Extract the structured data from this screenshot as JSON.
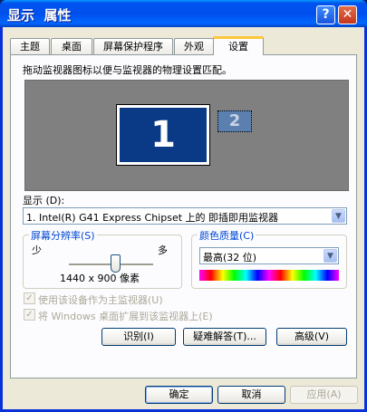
{
  "window": {
    "title": "显示  属性"
  },
  "titlebar_buttons": {
    "help": "?",
    "close": "✕"
  },
  "tabs": [
    {
      "label": "主题"
    },
    {
      "label": "桌面"
    },
    {
      "label": "屏幕保护程序"
    },
    {
      "label": "外观"
    },
    {
      "label": "设置",
      "active": true
    }
  ],
  "settings": {
    "instruction": "拖动监视器图标以便与监视器的物理设置匹配。",
    "monitors": [
      {
        "number": "1",
        "primary": true
      },
      {
        "number": "2"
      }
    ],
    "display_label": "显示 (D):",
    "display_value": "1. Intel(R) G41 Express Chipset 上的 即插即用监视器",
    "resolution": {
      "title": "屏幕分辨率(S)",
      "less": "少",
      "more": "多",
      "value": "1440 x 900 像素",
      "slider_position": 0.55
    },
    "color_quality": {
      "title": "颜色质量(C)",
      "value": "最高(32 位)"
    },
    "checkbox_primary": "使用该设备作为主监视器(U)",
    "checkbox_extend": "将 Windows 桌面扩展到该监视器上(E)",
    "buttons": {
      "identify": "识别(I)",
      "troubleshoot": "疑难解答(T)...",
      "advanced": "高级(V)"
    }
  },
  "footer": {
    "ok": "确定",
    "cancel": "取消",
    "apply": "应用(A)"
  },
  "colors": {
    "title_bar": "#0053ee",
    "face": "#ece9d8",
    "monitor_area": "#808080",
    "group_title": "#0046d5"
  }
}
